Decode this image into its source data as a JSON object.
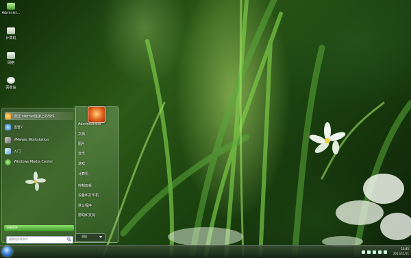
{
  "desktop": {
    "icons": [
      {
        "name": "administrator-folder-icon",
        "label": "Administ..."
      },
      {
        "name": "computer-icon",
        "label": "计算机"
      },
      {
        "name": "network-icon",
        "label": "网络"
      },
      {
        "name": "recycle-bin-icon",
        "label": "回收站"
      }
    ]
  },
  "start_menu": {
    "pinned": [
      {
        "label": "通过Internet连接上的软件",
        "icon": "globe-icon"
      },
      {
        "label": "迅雷7",
        "icon": "thunder-icon"
      },
      {
        "label": "VMware Workstation",
        "icon": "vmware-icon"
      },
      {
        "label": "入门",
        "icon": "getting-started-icon"
      },
      {
        "label": "Windows Media Center",
        "icon": "media-center-icon"
      }
    ],
    "all_programs": "所有程序",
    "search_placeholder": "搜索程序和文件",
    "user_name": "Administrator",
    "right_items": [
      "文档",
      "图片",
      "音乐",
      "游戏",
      "计算机",
      "控制面板",
      "设备和打印机",
      "默认程序",
      "帮助和支持"
    ],
    "shutdown_label": "关机"
  },
  "taskbar": {
    "time": "13:45",
    "date": "2011/11/11"
  },
  "colors": {
    "accent": "#3e9a2a",
    "start_orb": "#2a77d0"
  }
}
